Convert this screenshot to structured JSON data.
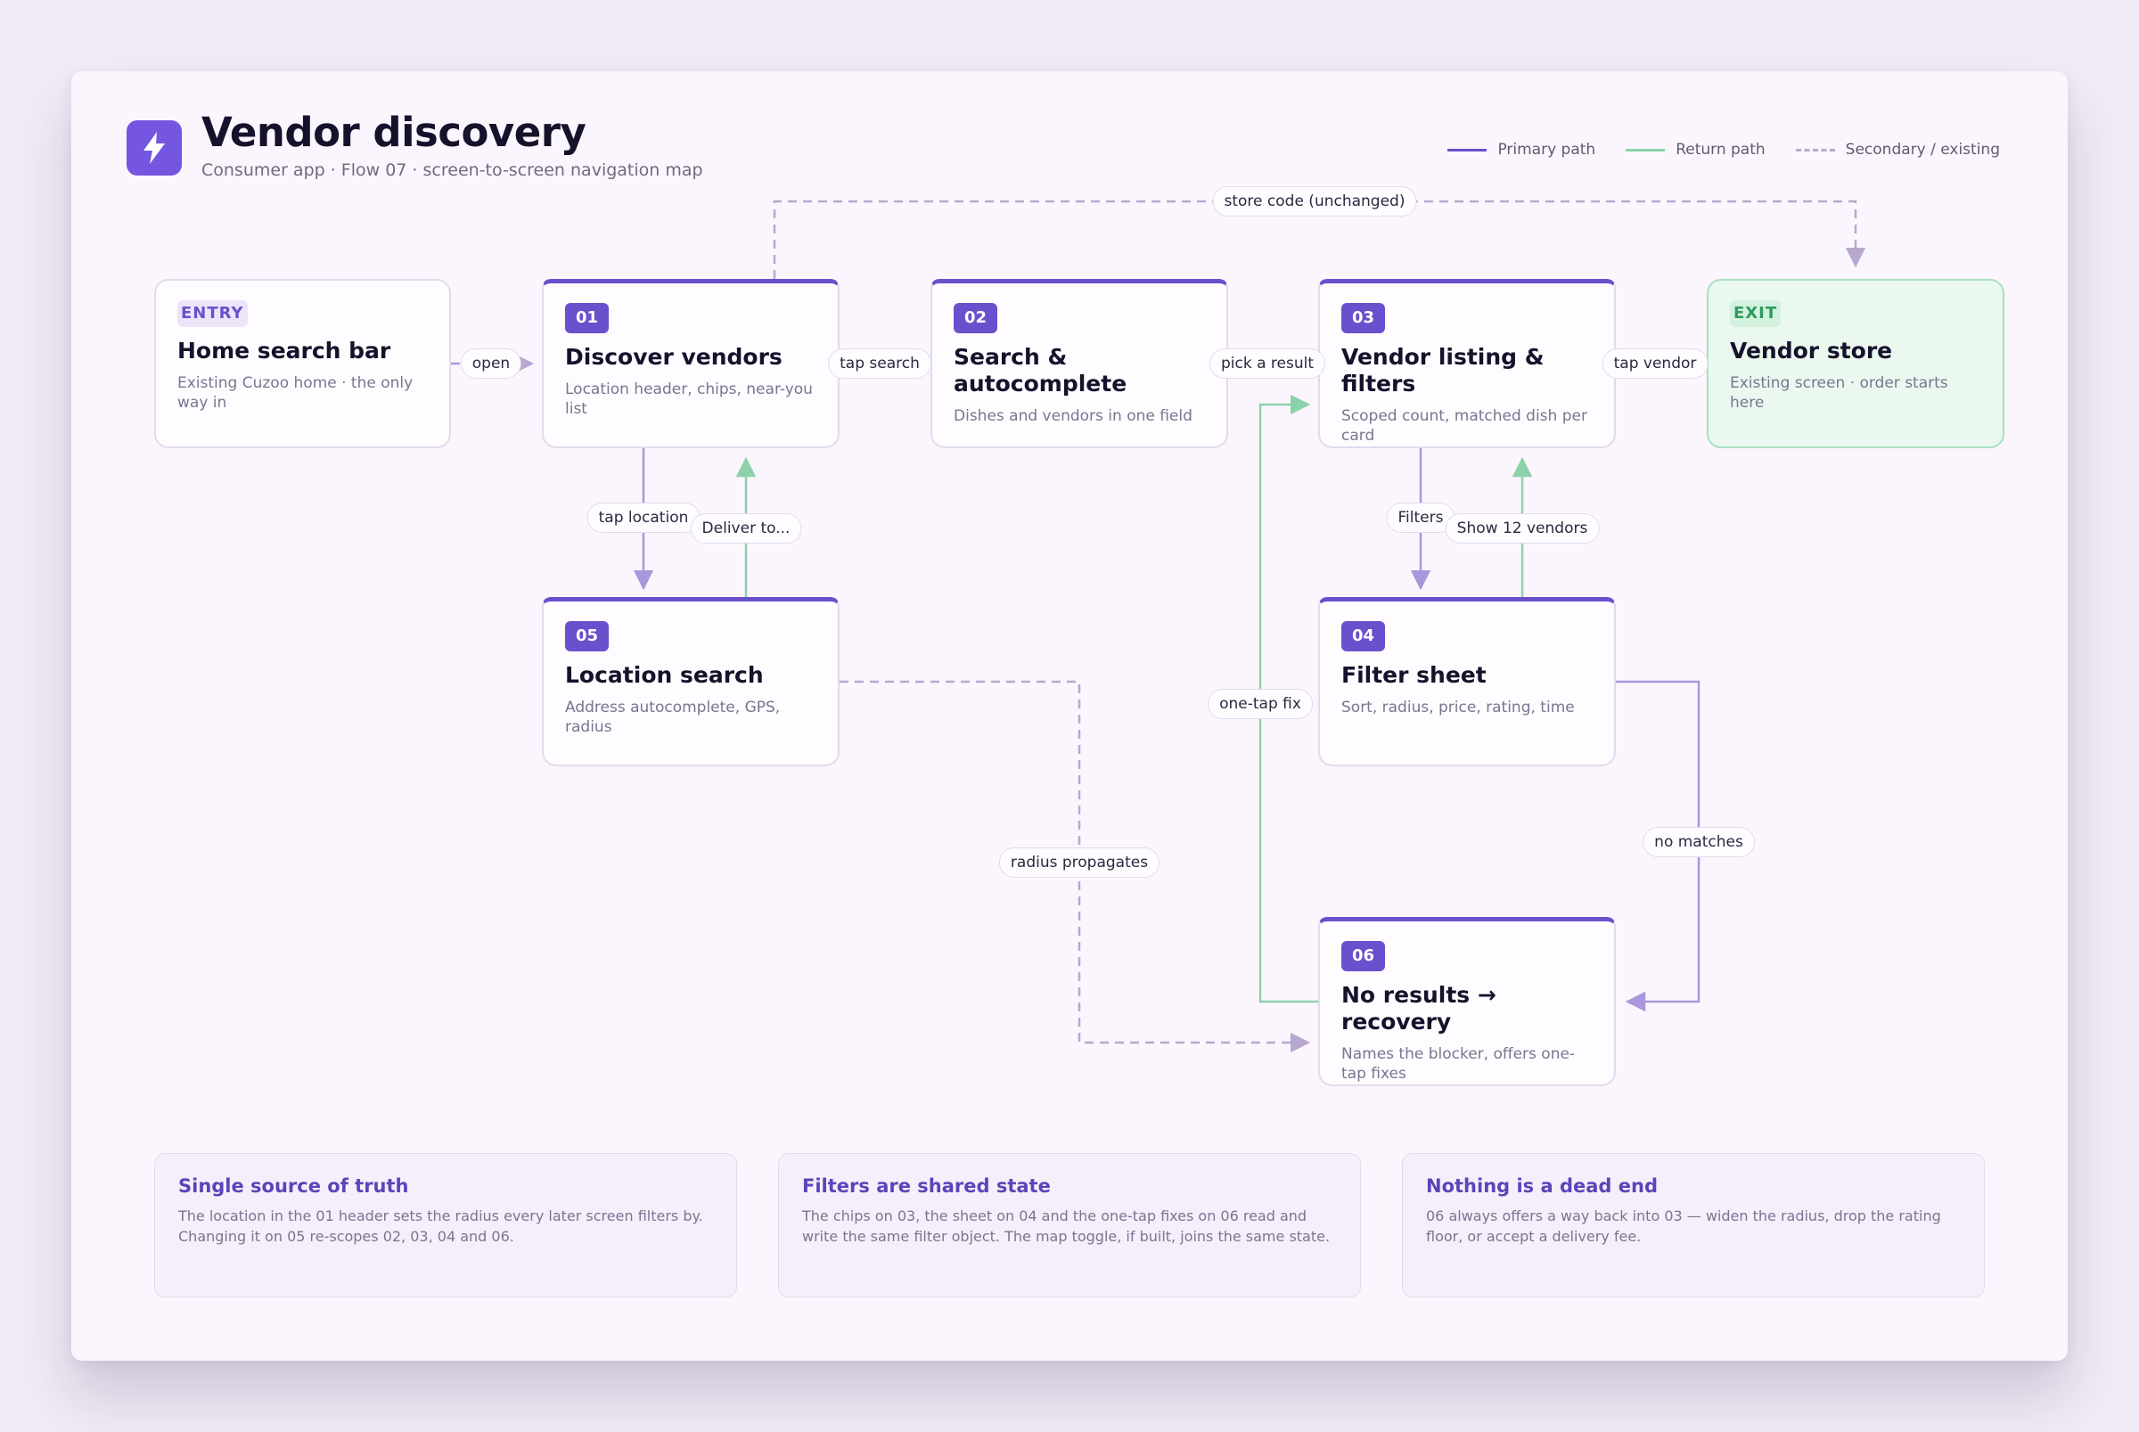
{
  "header": {
    "title": "Vendor discovery",
    "subtitle": "Consumer app · Flow 07 · screen-to-screen navigation map",
    "logo_icon": "lightning-bolt-icon"
  },
  "legend": {
    "primary": "Primary path",
    "return": "Return path",
    "secondary": "Secondary / existing"
  },
  "colors": {
    "primary": "#6a50cc",
    "return": "#8dd1aa",
    "secondary": "#b8a8cf",
    "accent": "#7556e0"
  },
  "nodes": {
    "entry": {
      "tag": "ENTRY",
      "title": "Home search bar",
      "desc": "Existing Cuzoo home · the only way in"
    },
    "n01": {
      "num": "01",
      "title": "Discover vendors",
      "desc": "Location header, chips, near-you list"
    },
    "n02": {
      "num": "02",
      "title": "Search & autocomplete",
      "desc": "Dishes and vendors in one field"
    },
    "n03": {
      "num": "03",
      "title": "Vendor listing & filters",
      "desc": "Scoped count, matched dish per card"
    },
    "exit": {
      "tag": "EXIT",
      "title": "Vendor store",
      "desc": "Existing screen · order starts here"
    },
    "n05": {
      "num": "05",
      "title": "Location search",
      "desc": "Address autocomplete, GPS, radius"
    },
    "n04": {
      "num": "04",
      "title": "Filter sheet",
      "desc": "Sort, radius, price, rating, time"
    },
    "n06": {
      "num": "06",
      "title": "No results → recovery",
      "desc": "Names the blocker, offers one-tap fixes"
    }
  },
  "edge_labels": {
    "open": "open",
    "tap_search": "tap search",
    "pick_result": "pick a result",
    "tap_vendor": "tap vendor",
    "store_code": "store code (unchanged)",
    "tap_location": "tap location",
    "deliver_to": "Deliver to...",
    "filters": "Filters",
    "show_vendors": "Show 12 vendors",
    "one_tap_fix": "one-tap fix",
    "radius_propagates": "radius propagates",
    "no_matches": "no matches"
  },
  "notes": [
    {
      "title": "Single source of truth",
      "text": "The location in the 01 header sets the radius every later screen filters by. Changing it on 05 re-scopes 02, 03, 04 and 06."
    },
    {
      "title": "Filters are shared state",
      "text": "The chips on 03, the sheet on 04 and the one-tap fixes on 06 read and write the same filter object. The map toggle, if built, joins the same state."
    },
    {
      "title": "Nothing is a dead end",
      "text": "06 always offers a way back into 03 — widen the radius, drop the rating floor, or accept a delivery fee."
    }
  ]
}
